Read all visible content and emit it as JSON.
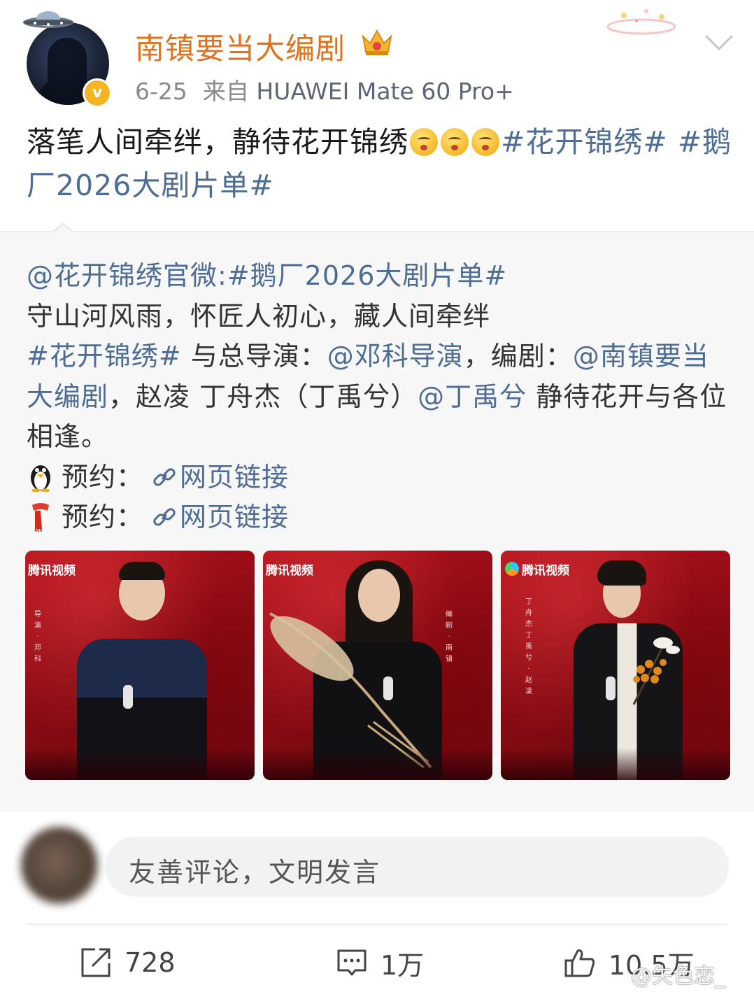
{
  "post": {
    "author": "南镇要当大编剧",
    "date": "6-25",
    "source_prefix": "来自",
    "device": "HUAWEI Mate 60 Pro+",
    "text_plain": "落笔人间牵绊，静待花开锦绣",
    "text_tags": "#花开锦绣# #鹅厂2026大剧片单#",
    "icons": [
      "ufo-avatar-decoration",
      "verified-badge-v",
      "crown-icon",
      "chevron-down-icon",
      "grimace-emoji"
    ]
  },
  "repost": {
    "account_mention": "@花开锦绣官微",
    "tag_after_mention": ":#鹅厂2026大剧片单#",
    "line2": "守山河风雨，怀匠人初心，藏人间牵绊",
    "line3_tag": "#花开锦绣#",
    "line3_text_a": " 与总导演：",
    "mention_director": "@邓科导演",
    "line3_text_b": "，编剧：",
    "mention_writer": "@南镇要当大编剧",
    "line3_text_c": "，赵凌 丁舟杰（丁禹兮）",
    "mention_actor": "@丁禹兮",
    "line3_text_d": " 静待花开与各位相逢。",
    "reserve1_label": "预约：",
    "reserve1_link": "网页链接",
    "reserve2_label": "预约：",
    "reserve2_link": "网页链接",
    "photos": [
      {
        "brand": "腾讯视频",
        "side_text": [
          "导",
          "演",
          "·",
          "邓",
          "科"
        ]
      },
      {
        "brand": "腾讯视频",
        "side_text": [
          "编",
          "剧",
          "·",
          "南",
          "镇"
        ]
      },
      {
        "brand": "腾讯视频",
        "side_text": [
          "丁",
          "舟",
          "杰",
          "丁",
          "禹",
          "兮",
          "·",
          "赵",
          "凌"
        ]
      }
    ]
  },
  "comment": {
    "placeholder": "友善评论，文明发言"
  },
  "actions": {
    "repost_count": "728",
    "comment_count": "1万",
    "like_count": "10.5万"
  },
  "watermark": "@失色恋_",
  "colors": {
    "username": "#e3721c",
    "link": "#4e6d95",
    "repost_bg": "#f7f7f7",
    "photo_red": "#a0101a"
  }
}
